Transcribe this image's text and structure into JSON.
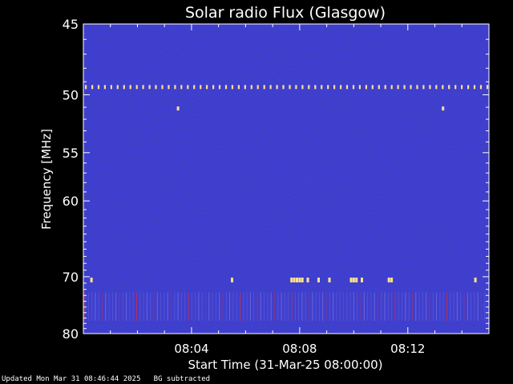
{
  "chart_data": {
    "type": "heatmap",
    "title": "Solar radio Flux (Glasgow)",
    "xlabel": "Start Time (31-Mar-25 08:00:00)",
    "ylabel": "Frequency [MHz]",
    "x_range_minutes": [
      0,
      15
    ],
    "x_ticks": [
      {
        "minute": 4,
        "label": "08:04"
      },
      {
        "minute": 8,
        "label": "08:08"
      },
      {
        "minute": 12,
        "label": "08:12"
      }
    ],
    "y_range_mhz": [
      45,
      80
    ],
    "y_ticks": [
      {
        "mhz": 45,
        "label": "45"
      },
      {
        "mhz": 50,
        "label": "50"
      },
      {
        "mhz": 55,
        "label": "55"
      },
      {
        "mhz": 60,
        "label": "60"
      },
      {
        "mhz": 70,
        "label": "70"
      },
      {
        "mhz": 80,
        "label": "80"
      }
    ],
    "y_scale": "reciprocal",
    "background_color": "#1a1aa8",
    "feature_colors": {
      "hot": "#ffe08a",
      "warm": "#c0304a"
    },
    "features": [
      {
        "kind": "interference-line",
        "mhz": 49.4,
        "from_min": 0,
        "to_min": 15
      },
      {
        "kind": "spot",
        "mhz": 51.1,
        "minute": 3.5
      },
      {
        "kind": "spot",
        "mhz": 51.1,
        "minute": 13.3
      },
      {
        "kind": "burst-row",
        "mhz": 70.5,
        "minutes": [
          0.3,
          5.5,
          7.7,
          7.8,
          7.9,
          8.0,
          8.1,
          8.3,
          8.7,
          9.1,
          9.9,
          10.0,
          10.1,
          10.3,
          11.3,
          11.4,
          14.5
        ]
      },
      {
        "kind": "striated-band",
        "mhz_from": 72.5,
        "mhz_to": 77.5
      }
    ]
  },
  "footer": {
    "updated": "Updated Mon Mar 31 08:46:44 2025",
    "note": "BG subtracted"
  }
}
